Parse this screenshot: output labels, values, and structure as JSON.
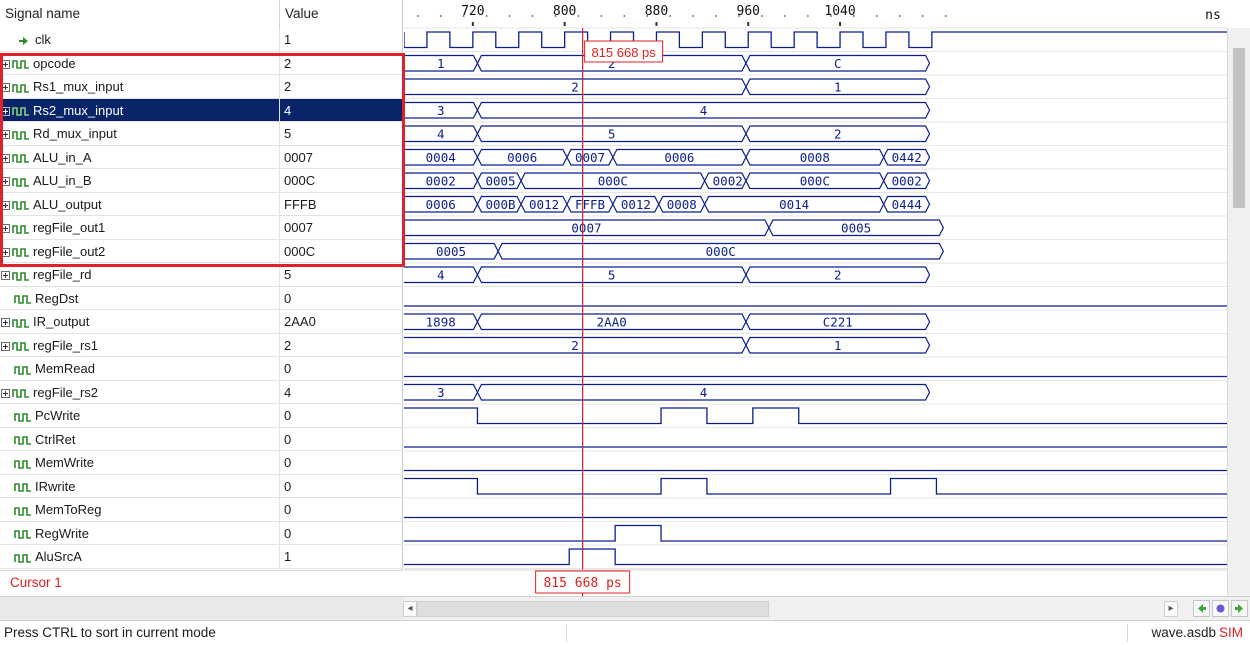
{
  "header": {
    "signal_col": "Signal name",
    "value_col": "Value"
  },
  "timeline": {
    "unit": "ns",
    "ticks": [
      {
        "label": "720",
        "t": 720
      },
      {
        "label": "800",
        "t": 800
      },
      {
        "label": "880",
        "t": 880
      },
      {
        "label": "960",
        "t": 960
      },
      {
        "label": "1040",
        "t": 1040
      }
    ],
    "cursor_label": "815 668 ps",
    "cursor_time": 815.668
  },
  "signals": [
    {
      "name": "clk",
      "value": "1",
      "kind": "clock",
      "expandable": false,
      "edges": [
        660,
        680,
        700,
        720,
        740,
        760,
        780,
        800,
        820,
        840,
        860,
        880,
        900,
        920,
        940,
        960,
        980,
        1000,
        1020,
        1040,
        1060,
        1080,
        1100,
        1120
      ],
      "start": 1
    },
    {
      "name": "opcode",
      "value": "2",
      "kind": "bus",
      "expandable": true,
      "segments": [
        {
          "until": 724,
          "label": "1"
        },
        {
          "until": 958,
          "label": "2"
        },
        {
          "until": 1118,
          "label": "C"
        }
      ]
    },
    {
      "name": "Rs1_mux_input",
      "value": "2",
      "kind": "bus",
      "expandable": true,
      "segments": [
        {
          "until": 958,
          "label": "2"
        },
        {
          "until": 1118,
          "label": "1"
        }
      ]
    },
    {
      "name": "Rs2_mux_input",
      "value": "4",
      "kind": "bus",
      "expandable": true,
      "selected": true,
      "segments": [
        {
          "until": 724,
          "label": "3"
        },
        {
          "until": 1118,
          "label": "4"
        }
      ]
    },
    {
      "name": "Rd_mux_input",
      "value": "5",
      "kind": "bus",
      "expandable": true,
      "segments": [
        {
          "until": 724,
          "label": "4"
        },
        {
          "until": 958,
          "label": "5"
        },
        {
          "until": 1118,
          "label": "2"
        }
      ]
    },
    {
      "name": "ALU_in_A",
      "value": "0007",
      "kind": "bus",
      "expandable": true,
      "segments": [
        {
          "until": 724,
          "label": "0004"
        },
        {
          "until": 802,
          "label": "0006"
        },
        {
          "until": 842,
          "label": "0007"
        },
        {
          "until": 958,
          "label": "0006"
        },
        {
          "until": 1078,
          "label": "0008"
        },
        {
          "until": 1118,
          "label": "0442"
        }
      ]
    },
    {
      "name": "ALU_in_B",
      "value": "000C",
      "kind": "bus",
      "expandable": true,
      "segments": [
        {
          "until": 724,
          "label": "0002"
        },
        {
          "until": 762,
          "label": "0005"
        },
        {
          "until": 922,
          "label": "000C"
        },
        {
          "until": 958,
          "label": "0002"
        },
        {
          "until": 1078,
          "label": "000C"
        },
        {
          "until": 1118,
          "label": "0002"
        }
      ]
    },
    {
      "name": "ALU_output",
      "value": "FFFB",
      "kind": "bus",
      "expandable": true,
      "segments": [
        {
          "until": 724,
          "label": "0006"
        },
        {
          "until": 762,
          "label": "000B"
        },
        {
          "until": 802,
          "label": "0012"
        },
        {
          "until": 842,
          "label": "FFFB"
        },
        {
          "until": 882,
          "label": "0012"
        },
        {
          "until": 922,
          "label": "0008"
        },
        {
          "until": 1078,
          "label": "0014"
        },
        {
          "until": 1118,
          "label": "0444"
        }
      ]
    },
    {
      "name": "regFile_out1",
      "value": "0007",
      "kind": "bus",
      "expandable": true,
      "segments": [
        {
          "until": 978,
          "label": "0007"
        },
        {
          "until": 1130,
          "label": "0005"
        }
      ]
    },
    {
      "name": "regFile_out2",
      "value": "000C",
      "kind": "bus",
      "expandable": true,
      "segments": [
        {
          "until": 742,
          "label": "0005"
        },
        {
          "until": 1130,
          "label": "000C"
        }
      ]
    },
    {
      "name": "regFile_rd",
      "value": "5",
      "kind": "bus",
      "expandable": true,
      "segments": [
        {
          "until": 724,
          "label": "4"
        },
        {
          "until": 958,
          "label": "5"
        },
        {
          "until": 1118,
          "label": "2"
        }
      ]
    },
    {
      "name": "RegDst",
      "value": "0",
      "kind": "bit",
      "expandable": false,
      "levels": [
        [
          660,
          0
        ]
      ]
    },
    {
      "name": "IR_output",
      "value": "2AA0",
      "kind": "bus",
      "expandable": true,
      "segments": [
        {
          "until": 724,
          "label": "1898"
        },
        {
          "until": 958,
          "label": "2AA0"
        },
        {
          "until": 1118,
          "label": "C221"
        }
      ]
    },
    {
      "name": "regFile_rs1",
      "value": "2",
      "kind": "bus",
      "expandable": true,
      "segments": [
        {
          "until": 958,
          "label": "2"
        },
        {
          "until": 1118,
          "label": "1"
        }
      ]
    },
    {
      "name": "MemRead",
      "value": "0",
      "kind": "bit",
      "expandable": false,
      "levels": [
        [
          660,
          0
        ]
      ]
    },
    {
      "name": "regFile_rs2",
      "value": "4",
      "kind": "bus",
      "expandable": true,
      "segments": [
        {
          "until": 724,
          "label": "3"
        },
        {
          "until": 1118,
          "label": "4"
        }
      ]
    },
    {
      "name": "PcWrite",
      "value": "0",
      "kind": "bit",
      "expandable": false,
      "levels": [
        [
          660,
          1
        ],
        [
          724,
          0
        ],
        [
          884,
          1
        ],
        [
          924,
          0
        ],
        [
          964,
          1
        ],
        [
          1004,
          0
        ]
      ]
    },
    {
      "name": "CtrlRet",
      "value": "0",
      "kind": "bit",
      "expandable": false,
      "levels": [
        [
          660,
          0
        ]
      ]
    },
    {
      "name": "MemWrite",
      "value": "0",
      "kind": "bit",
      "expandable": false,
      "levels": [
        [
          660,
          0
        ]
      ]
    },
    {
      "name": "IRwrite",
      "value": "0",
      "kind": "bit",
      "expandable": false,
      "levels": [
        [
          660,
          1
        ],
        [
          724,
          0
        ],
        [
          884,
          1
        ],
        [
          924,
          0
        ],
        [
          1084,
          1
        ],
        [
          1124,
          0
        ]
      ]
    },
    {
      "name": "MemToReg",
      "value": "0",
      "kind": "bit",
      "expandable": false,
      "levels": [
        [
          660,
          0
        ]
      ]
    },
    {
      "name": "RegWrite",
      "value": "0",
      "kind": "bit",
      "expandable": false,
      "levels": [
        [
          660,
          0
        ],
        [
          844,
          1
        ],
        [
          884,
          0
        ]
      ]
    },
    {
      "name": "AluSrcA",
      "value": "1",
      "kind": "bit",
      "expandable": false,
      "levels": [
        [
          660,
          0
        ],
        [
          804,
          1
        ],
        [
          844,
          0
        ]
      ]
    }
  ],
  "cursor_row_label": "Cursor 1",
  "status": {
    "message": "Press CTRL to sort in current mode",
    "file": "wave.asdb",
    "mode": "SIM"
  },
  "colors": {
    "wave": "#0a1f8f",
    "cursor": "#e02020",
    "selected_row": "#0a246a",
    "icon_green": "#2e8b2e",
    "highlight": "#e0202a"
  },
  "icons": {
    "clock": "clock-arrow-icon",
    "signal": "waveform-icon",
    "expand": "plus-box-icon"
  }
}
